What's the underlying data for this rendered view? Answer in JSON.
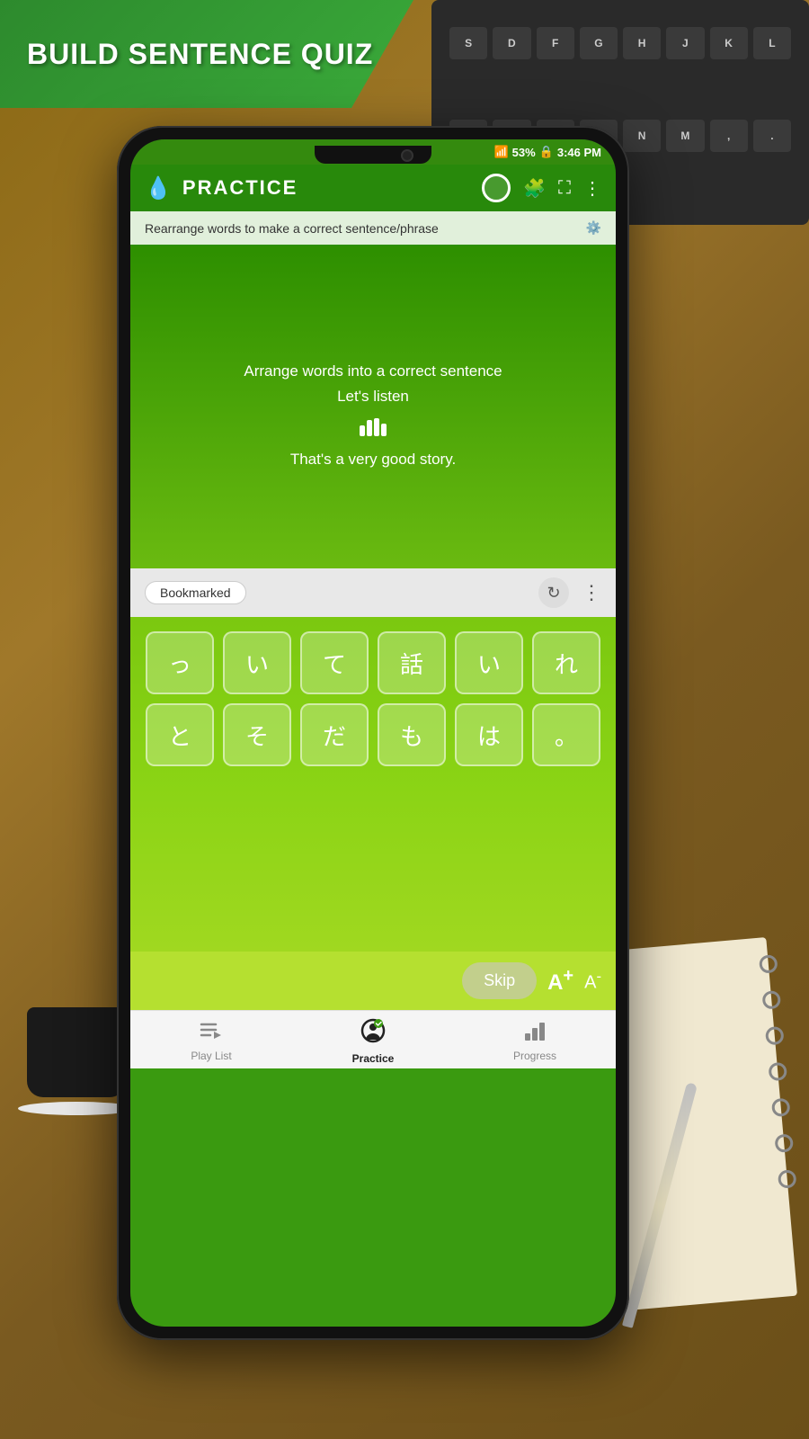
{
  "banner": {
    "text": "BUILD SENTENCE QUIZ"
  },
  "status_bar": {
    "signal": "53%",
    "time": "3:46 PM",
    "battery_icon": "🔒"
  },
  "header": {
    "icon": "💧",
    "title": "PRACTICE",
    "actions": [
      "circle",
      "puzzle",
      "expand",
      "more"
    ]
  },
  "instruction": {
    "text": "Rearrange words to make a correct sentence/phrase",
    "settings_icon": "⚙"
  },
  "main": {
    "arrange_label": "Arrange words into a correct sentence",
    "listen_label": "Let's listen",
    "audio_bars": "📊",
    "translation": "That's a very good story."
  },
  "bookmark_bar": {
    "label": "Bookmarked",
    "refresh_icon": "↺",
    "more_icon": "⋮"
  },
  "word_tiles": {
    "row1": [
      "っ",
      "い",
      "て",
      "話",
      "い",
      "れ"
    ],
    "row2": [
      "と",
      "そ",
      "だ",
      "も",
      "は",
      "。"
    ]
  },
  "bottom_controls": {
    "skip_label": "Skip",
    "font_increase": "A⁺",
    "font_decrease": "A⁻"
  },
  "nav": {
    "items": [
      {
        "icon": "playlist",
        "label": "Play List",
        "active": false
      },
      {
        "icon": "practice",
        "label": "Practice",
        "active": true
      },
      {
        "icon": "progress",
        "label": "Progress",
        "active": false
      }
    ]
  }
}
